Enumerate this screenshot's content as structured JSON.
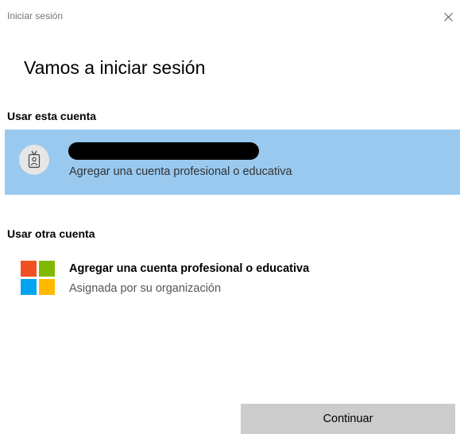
{
  "window": {
    "title": "Iniciar sesión",
    "close_glyph": "×"
  },
  "heading": "Vamos a iniciar sesión",
  "current_account": {
    "section_label": "Usar esta cuenta",
    "account_name": "[redacted]",
    "description": "Agregar una cuenta profesional o educativa",
    "icon": "id-badge-icon",
    "selected": true,
    "highlight_color": "#99c9ef"
  },
  "other_account": {
    "section_label": "Usar otra cuenta",
    "title": "Agregar una cuenta profesional o educativa",
    "subtitle": "Asignada por su organización",
    "icon": "microsoft-logo-icon",
    "logo_colors": [
      "#f25022",
      "#7fba00",
      "#00a4ef",
      "#ffb900"
    ]
  },
  "footer": {
    "continue_label": "Continuar",
    "continue_enabled": false
  }
}
